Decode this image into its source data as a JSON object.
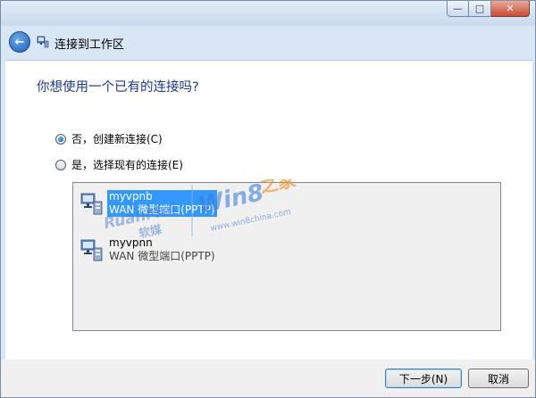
{
  "window": {
    "controls": {
      "minimize": "—",
      "maximize": "□",
      "close": "✕"
    }
  },
  "header": {
    "title": "连接到工作区",
    "back_icon": "arrow-left-icon"
  },
  "main": {
    "question": "你想使用一个已有的连接吗?",
    "options": [
      {
        "label": "否，创建新连接(C)",
        "selected": true
      },
      {
        "label": "是，选择现有的连接(E)",
        "selected": false
      }
    ],
    "connections": [
      {
        "name": "myvpnb",
        "type": "WAN 微型端口(PPTP)",
        "selected": true
      },
      {
        "name": "myvpnn",
        "type": "WAN 微型端口(PPTP)",
        "selected": false
      }
    ]
  },
  "watermark": {
    "brand": "Win8之家",
    "url": "www.win8china.com",
    "logo": "RuanMei 软媒"
  },
  "footer": {
    "next_label": "下一步(N)",
    "cancel_label": "取消"
  },
  "colors": {
    "selection": "#3399ff",
    "question_text": "#1e3a8a",
    "frame": "#d9e6f5"
  }
}
